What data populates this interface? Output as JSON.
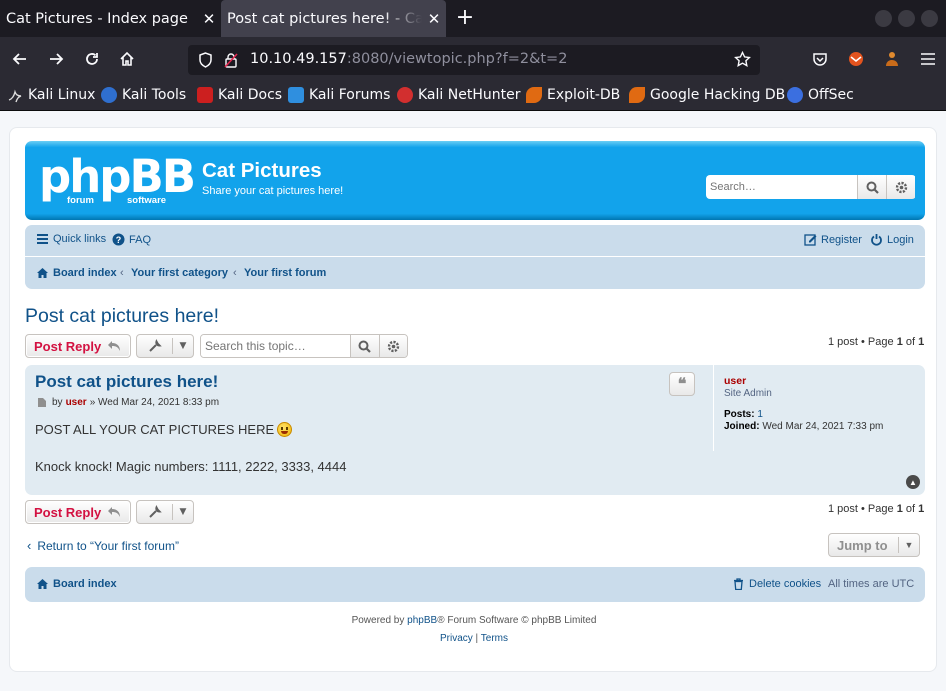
{
  "browser": {
    "tabs": [
      {
        "title": "Cat Pictures - Index page"
      },
      {
        "title": "Post cat pictures here! - Cat Pictures"
      }
    ],
    "url_host": "10.10.49.157",
    "url_rest": ":8080/viewtopic.php?f=2&t=2",
    "bookmarks": [
      {
        "label": "Kali Linux",
        "icon": "kali-dragon-icon",
        "color": "#1e1e1e"
      },
      {
        "label": "Kali Tools",
        "icon": "kali-tools-icon",
        "color": "#2f6fcf"
      },
      {
        "label": "Kali Docs",
        "icon": "kali-docs-icon",
        "color": "#cc1f1f"
      },
      {
        "label": "Kali Forums",
        "icon": "kali-forums-icon",
        "color": "#2f8fdf"
      },
      {
        "label": "Kali NetHunter",
        "icon": "nethunter-icon",
        "color": "#d22f2f"
      },
      {
        "label": "Exploit-DB",
        "icon": "exploit-db-icon",
        "color": "#e06a12"
      },
      {
        "label": "Google Hacking DB",
        "icon": "ghdb-icon",
        "color": "#e06a12"
      },
      {
        "label": "OffSec",
        "icon": "offsec-icon",
        "color": "#3b6fe0"
      }
    ]
  },
  "site": {
    "logo_main": "phpBB",
    "logo_sub1": "forum",
    "logo_sub2": "software",
    "name": "Cat Pictures",
    "description": "Share your cat pictures here!",
    "search_placeholder": "Search…"
  },
  "nav": {
    "quick_links": "Quick links",
    "faq": "FAQ",
    "register": "Register",
    "login": "Login",
    "breadcrumbs": [
      "Board index",
      "Your first category",
      "Your first forum"
    ]
  },
  "topic": {
    "title": "Post cat pictures here!",
    "post_reply": "Post Reply",
    "search_placeholder": "Search this topic…",
    "pagination_prefix": "1 post • Page ",
    "page_current": "1",
    "page_of": " of ",
    "page_total": "1"
  },
  "post": {
    "subject": "Post cat pictures here!",
    "by": "by",
    "author": "user",
    "date": "» Wed Mar 24, 2021 8:33 pm",
    "line1": "POST ALL YOUR CAT PICTURES HERE",
    "line2": "Knock knock! Magic numbers: 1111, 2222, 3333, 4444",
    "profile": {
      "name": "user",
      "rank": "Site Admin",
      "posts_label": "Posts:",
      "posts_value": "1",
      "joined_label": "Joined:",
      "joined_value": "Wed Mar 24, 2021 7:33 pm"
    }
  },
  "bottom": {
    "return_link": "Return to “Your first forum”",
    "jump_to": "Jump to",
    "board_index": "Board index",
    "delete_cookies": "Delete cookies",
    "timezone": "All times are UTC"
  },
  "footer": {
    "powered_prefix": "Powered by ",
    "powered_link": "phpBB",
    "powered_suffix": "® Forum Software © phpBB Limited",
    "privacy": "Privacy",
    "sep": " | ",
    "terms": "Terms"
  },
  "colors": {
    "header_blue": "#12a3eb",
    "link_blue": "#105289",
    "reply_red": "#d31141",
    "admin_red": "#aa0000",
    "panel_bg": "#cadceb",
    "post_bg": "#e1ebf2"
  }
}
